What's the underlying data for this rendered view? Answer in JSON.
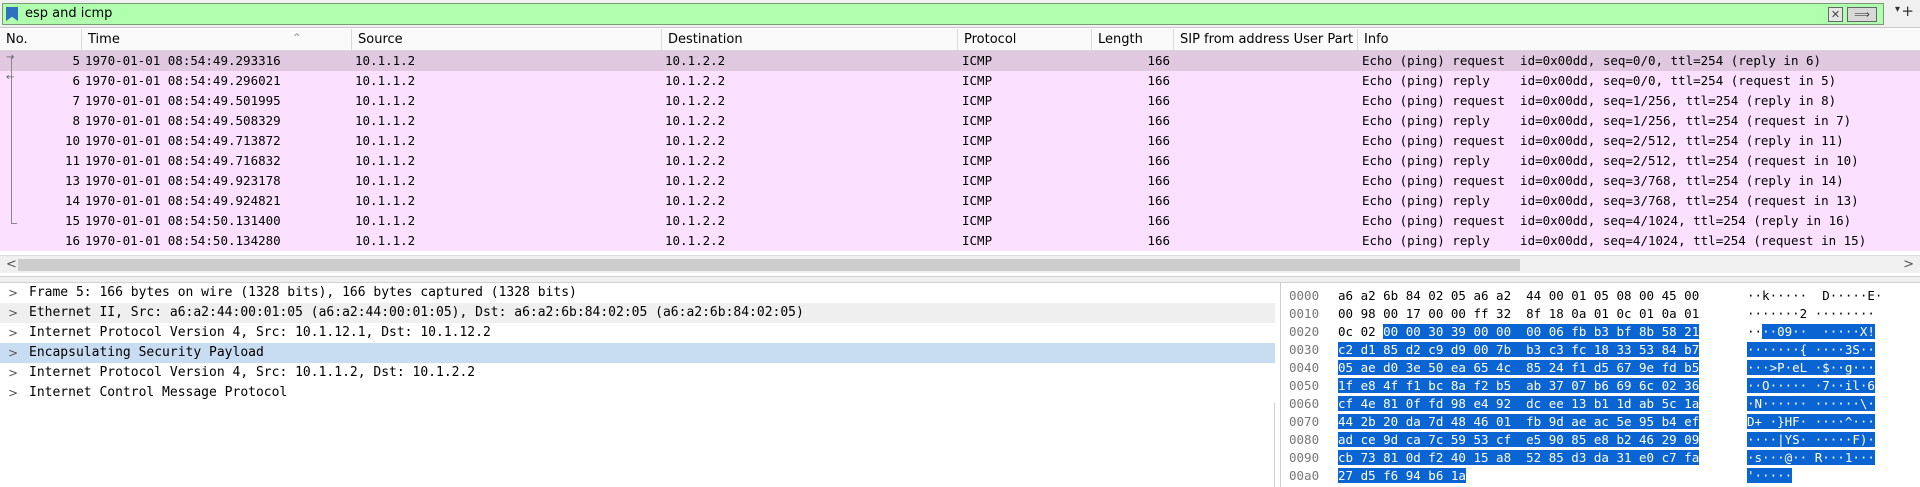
{
  "filter": {
    "text": "esp and icmp",
    "clear_label": "✕",
    "apply_label": "⟹",
    "dropdown_label": "▾",
    "add_label": "+"
  },
  "packet_list": {
    "columns": [
      "No.",
      "Time",
      "Source",
      "Destination",
      "Protocol",
      "Length",
      "SIP from address User Part",
      "Info"
    ],
    "rows": [
      {
        "no": "5",
        "time": "1970-01-01 08:54:49.293316",
        "src": "10.1.1.2",
        "dst": "10.1.2.2",
        "proto": "ICMP",
        "len": "166",
        "sip": "",
        "info": "Echo (ping) request  id=0x00dd, seq=0/0, ttl=254 (reply in 6)"
      },
      {
        "no": "6",
        "time": "1970-01-01 08:54:49.296021",
        "src": "10.1.1.2",
        "dst": "10.1.2.2",
        "proto": "ICMP",
        "len": "166",
        "sip": "",
        "info": "Echo (ping) reply    id=0x00dd, seq=0/0, ttl=254 (request in 5)"
      },
      {
        "no": "7",
        "time": "1970-01-01 08:54:49.501995",
        "src": "10.1.1.2",
        "dst": "10.1.2.2",
        "proto": "ICMP",
        "len": "166",
        "sip": "",
        "info": "Echo (ping) request  id=0x00dd, seq=1/256, ttl=254 (reply in 8)"
      },
      {
        "no": "8",
        "time": "1970-01-01 08:54:49.508329",
        "src": "10.1.1.2",
        "dst": "10.1.2.2",
        "proto": "ICMP",
        "len": "166",
        "sip": "",
        "info": "Echo (ping) reply    id=0x00dd, seq=1/256, ttl=254 (request in 7)"
      },
      {
        "no": "10",
        "time": "1970-01-01 08:54:49.713872",
        "src": "10.1.1.2",
        "dst": "10.1.2.2",
        "proto": "ICMP",
        "len": "166",
        "sip": "",
        "info": "Echo (ping) request  id=0x00dd, seq=2/512, ttl=254 (reply in 11)"
      },
      {
        "no": "11",
        "time": "1970-01-01 08:54:49.716832",
        "src": "10.1.1.2",
        "dst": "10.1.2.2",
        "proto": "ICMP",
        "len": "166",
        "sip": "",
        "info": "Echo (ping) reply    id=0x00dd, seq=2/512, ttl=254 (request in 10)"
      },
      {
        "no": "13",
        "time": "1970-01-01 08:54:49.923178",
        "src": "10.1.1.2",
        "dst": "10.1.2.2",
        "proto": "ICMP",
        "len": "166",
        "sip": "",
        "info": "Echo (ping) request  id=0x00dd, seq=3/768, ttl=254 (reply in 14)"
      },
      {
        "no": "14",
        "time": "1970-01-01 08:54:49.924821",
        "src": "10.1.1.2",
        "dst": "10.1.2.2",
        "proto": "ICMP",
        "len": "166",
        "sip": "",
        "info": "Echo (ping) reply    id=0x00dd, seq=3/768, ttl=254 (request in 13)"
      },
      {
        "no": "15",
        "time": "1970-01-01 08:54:50.131400",
        "src": "10.1.1.2",
        "dst": "10.1.2.2",
        "proto": "ICMP",
        "len": "166",
        "sip": "",
        "info": "Echo (ping) request  id=0x00dd, seq=4/1024, ttl=254 (reply in 16)"
      },
      {
        "no": "16",
        "time": "1970-01-01 08:54:50.134280",
        "src": "10.1.1.2",
        "dst": "10.1.2.2",
        "proto": "ICMP",
        "len": "166",
        "sip": "",
        "info": "Echo (ping) reply    id=0x00dd, seq=4/1024, ttl=254 (request in 15)"
      }
    ],
    "scroll_left": "<",
    "scroll_right": ">"
  },
  "details": [
    {
      "label": "Frame 5: 166 bytes on wire (1328 bits), 166 bytes captured (1328 bits)",
      "style": "normal"
    },
    {
      "label": "Ethernet II, Src: a6:a2:44:00:01:05 (a6:a2:44:00:01:05), Dst: a6:a2:6b:84:02:05 (a6:a2:6b:84:02:05)",
      "style": "alt"
    },
    {
      "label": "Internet Protocol Version 4, Src: 10.1.12.1, Dst: 10.1.12.2",
      "style": "normal"
    },
    {
      "label": "Encapsulating Security Payload",
      "style": "hl"
    },
    {
      "label": "Internet Protocol Version 4, Src: 10.1.1.2, Dst: 10.1.2.2",
      "style": "normal"
    },
    {
      "label": "Internet Control Message Protocol",
      "style": "normal"
    }
  ],
  "bytes": [
    {
      "off": "0000",
      "pre": "a6 a2 6b 84 02 05 a6 a2  44 00 01 05 08 00 45 00",
      "sel": "",
      "apre": "··k·····  D·····E·",
      "asel": ""
    },
    {
      "off": "0010",
      "pre": "00 98 00 17 00 00 ff 32  8f 18 0a 01 0c 01 0a 01",
      "sel": "",
      "apre": "·······2 ········",
      "asel": ""
    },
    {
      "off": "0020",
      "pre": "0c 02 ",
      "sel": "00 00 30 39 00 00  00 06 fb b3 bf 8b 58 21",
      "apre": "··",
      "asel": "··09··  ·····X!"
    },
    {
      "off": "0030",
      "pre": "",
      "sel": "c2 d1 85 d2 c9 d9 00 7b  b3 c3 fc 18 33 53 84 b7",
      "apre": "",
      "asel": "·······{ ····3S··"
    },
    {
      "off": "0040",
      "pre": "",
      "sel": "05 ae d0 3e 50 ea 65 4c  85 24 f1 d5 67 9e fd b5",
      "apre": "",
      "asel": "···>P·eL ·$··g···"
    },
    {
      "off": "0050",
      "pre": "",
      "sel": "1f e8 4f f1 bc 8a f2 b5  ab 37 07 b6 69 6c 02 36",
      "apre": "",
      "asel": "··O····· ·7··il·6"
    },
    {
      "off": "0060",
      "pre": "",
      "sel": "cf 4e 81 0f fd 98 e4 92  dc ee 13 b1 1d ab 5c 1a",
      "apre": "",
      "asel": "·N······ ······\\·"
    },
    {
      "off": "0070",
      "pre": "",
      "sel": "44 2b 20 da 7d 48 46 01  fb 9d ae ac 5e 95 b4 ef",
      "apre": "",
      "asel": "D+ ·}HF· ····^···"
    },
    {
      "off": "0080",
      "pre": "",
      "sel": "ad ce 9d ca 7c 59 53 cf  e5 90 85 e8 b2 46 29 09",
      "apre": "",
      "asel": "····|YS· ·····F)·"
    },
    {
      "off": "0090",
      "pre": "",
      "sel": "cb 73 81 0d f2 40 15 a8  52 85 d3 da 31 e0 c7 fa",
      "apre": "",
      "asel": "·s···@·· R···1···"
    },
    {
      "off": "00a0",
      "pre": "",
      "sel": "27 d5 f6 94 b6 1a",
      "apre": "",
      "asel": "'·····"
    }
  ]
}
